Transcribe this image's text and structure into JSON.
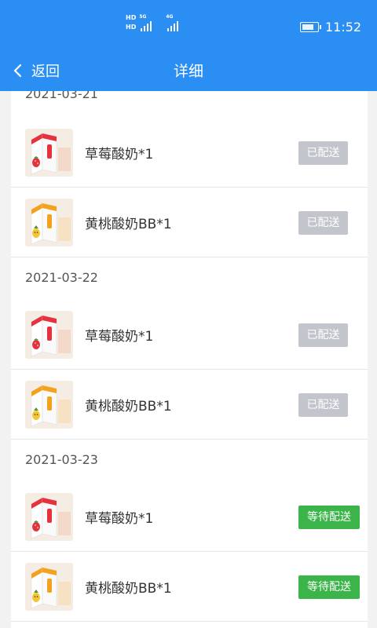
{
  "status_bar": {
    "hd1": "HD",
    "hd2": "HD",
    "net1": "5G",
    "net2": "4G",
    "battery_level": 0.85,
    "time": "11:52"
  },
  "nav": {
    "back_label": "返回",
    "title": "详细"
  },
  "groups": [
    {
      "date": "2021-03-21",
      "items": [
        {
          "name": "草莓酸奶*1",
          "status": "已配送"
        },
        {
          "name": "黄桃酸奶BB*1",
          "status": "已配送"
        }
      ]
    },
    {
      "date": "2021-03-22",
      "items": [
        {
          "name": "草莓酸奶*1",
          "status": "已配送"
        },
        {
          "name": "黄桃酸奶BB*1",
          "status": "已配送"
        }
      ]
    },
    {
      "date": "2021-03-23",
      "items": [
        {
          "name": "草莓酸奶*1",
          "status": "等待配送"
        },
        {
          "name": "黄桃酸奶BB*1",
          "status": "等待配送"
        }
      ]
    }
  ],
  "colors": {
    "primary": "#2b8ef3",
    "delivered_badge": "#c2c6cc",
    "waiting_badge": "#3bb54a"
  },
  "icons": {
    "back": "chevron-left-icon",
    "strawberry_thumb": "strawberry-yogurt-icon",
    "peach_thumb": "peach-yogurt-icon"
  }
}
